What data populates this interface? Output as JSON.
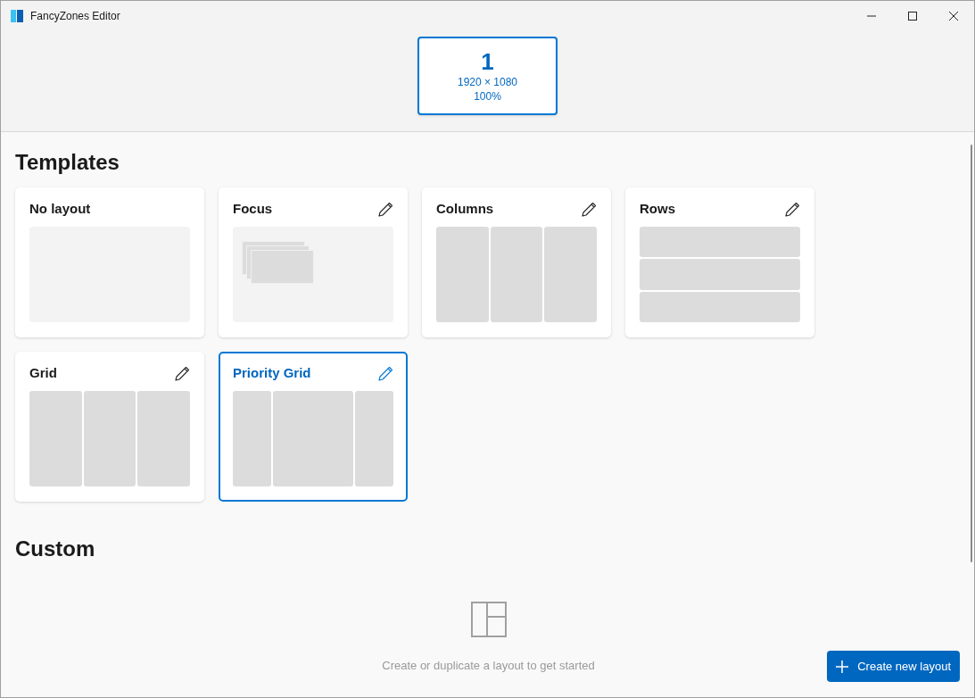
{
  "window": {
    "title": "FancyZones Editor"
  },
  "monitors": [
    {
      "number": "1",
      "resolution": "1920 × 1080",
      "scaling": "100%",
      "selected": true
    }
  ],
  "templates": {
    "heading": "Templates",
    "items": [
      {
        "name": "No layout",
        "kind": "blank",
        "editable": false,
        "selected": false
      },
      {
        "name": "Focus",
        "kind": "focus",
        "editable": true,
        "selected": false
      },
      {
        "name": "Columns",
        "kind": "columns",
        "editable": true,
        "selected": false
      },
      {
        "name": "Rows",
        "kind": "rows",
        "editable": true,
        "selected": false
      },
      {
        "name": "Grid",
        "kind": "grid",
        "editable": true,
        "selected": false
      },
      {
        "name": "Priority Grid",
        "kind": "priority-grid",
        "editable": true,
        "selected": true
      }
    ]
  },
  "custom": {
    "heading": "Custom",
    "empty_message": "Create or duplicate a layout to get started"
  },
  "create_button": {
    "label": "Create new layout"
  }
}
